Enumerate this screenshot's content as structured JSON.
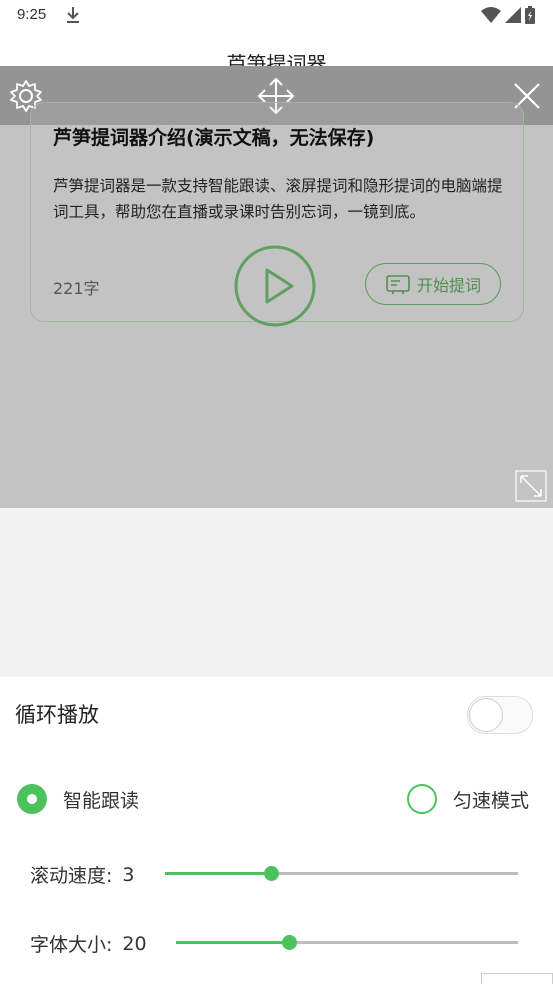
{
  "status_bar": {
    "time": "9:25"
  },
  "app": {
    "title": "芦笋提词器"
  },
  "card": {
    "title": "芦笋提词器介绍(演示文稿，无法保存)",
    "body": "芦笋提词器是一款支持智能跟读、滚屏提词和隐形提词的电脑端提词工具，帮助您在直播或录课时告别忘词，一镜到底。",
    "count": "221字",
    "start_label": "开始提词"
  },
  "settings": {
    "loop_label": "循环播放",
    "loop_on": false,
    "mode_smart": "智能跟读",
    "mode_uniform": "匀速模式",
    "selected_mode": "智能跟读",
    "speed_label": "滚动速度:",
    "speed_value": "3",
    "speed_fraction": 0.3,
    "font_label": "字体大小:",
    "font_value": "20",
    "font_fraction": 0.33
  },
  "colors": {
    "accent": "#4cc25c",
    "overlay": "#c3c3c3"
  }
}
